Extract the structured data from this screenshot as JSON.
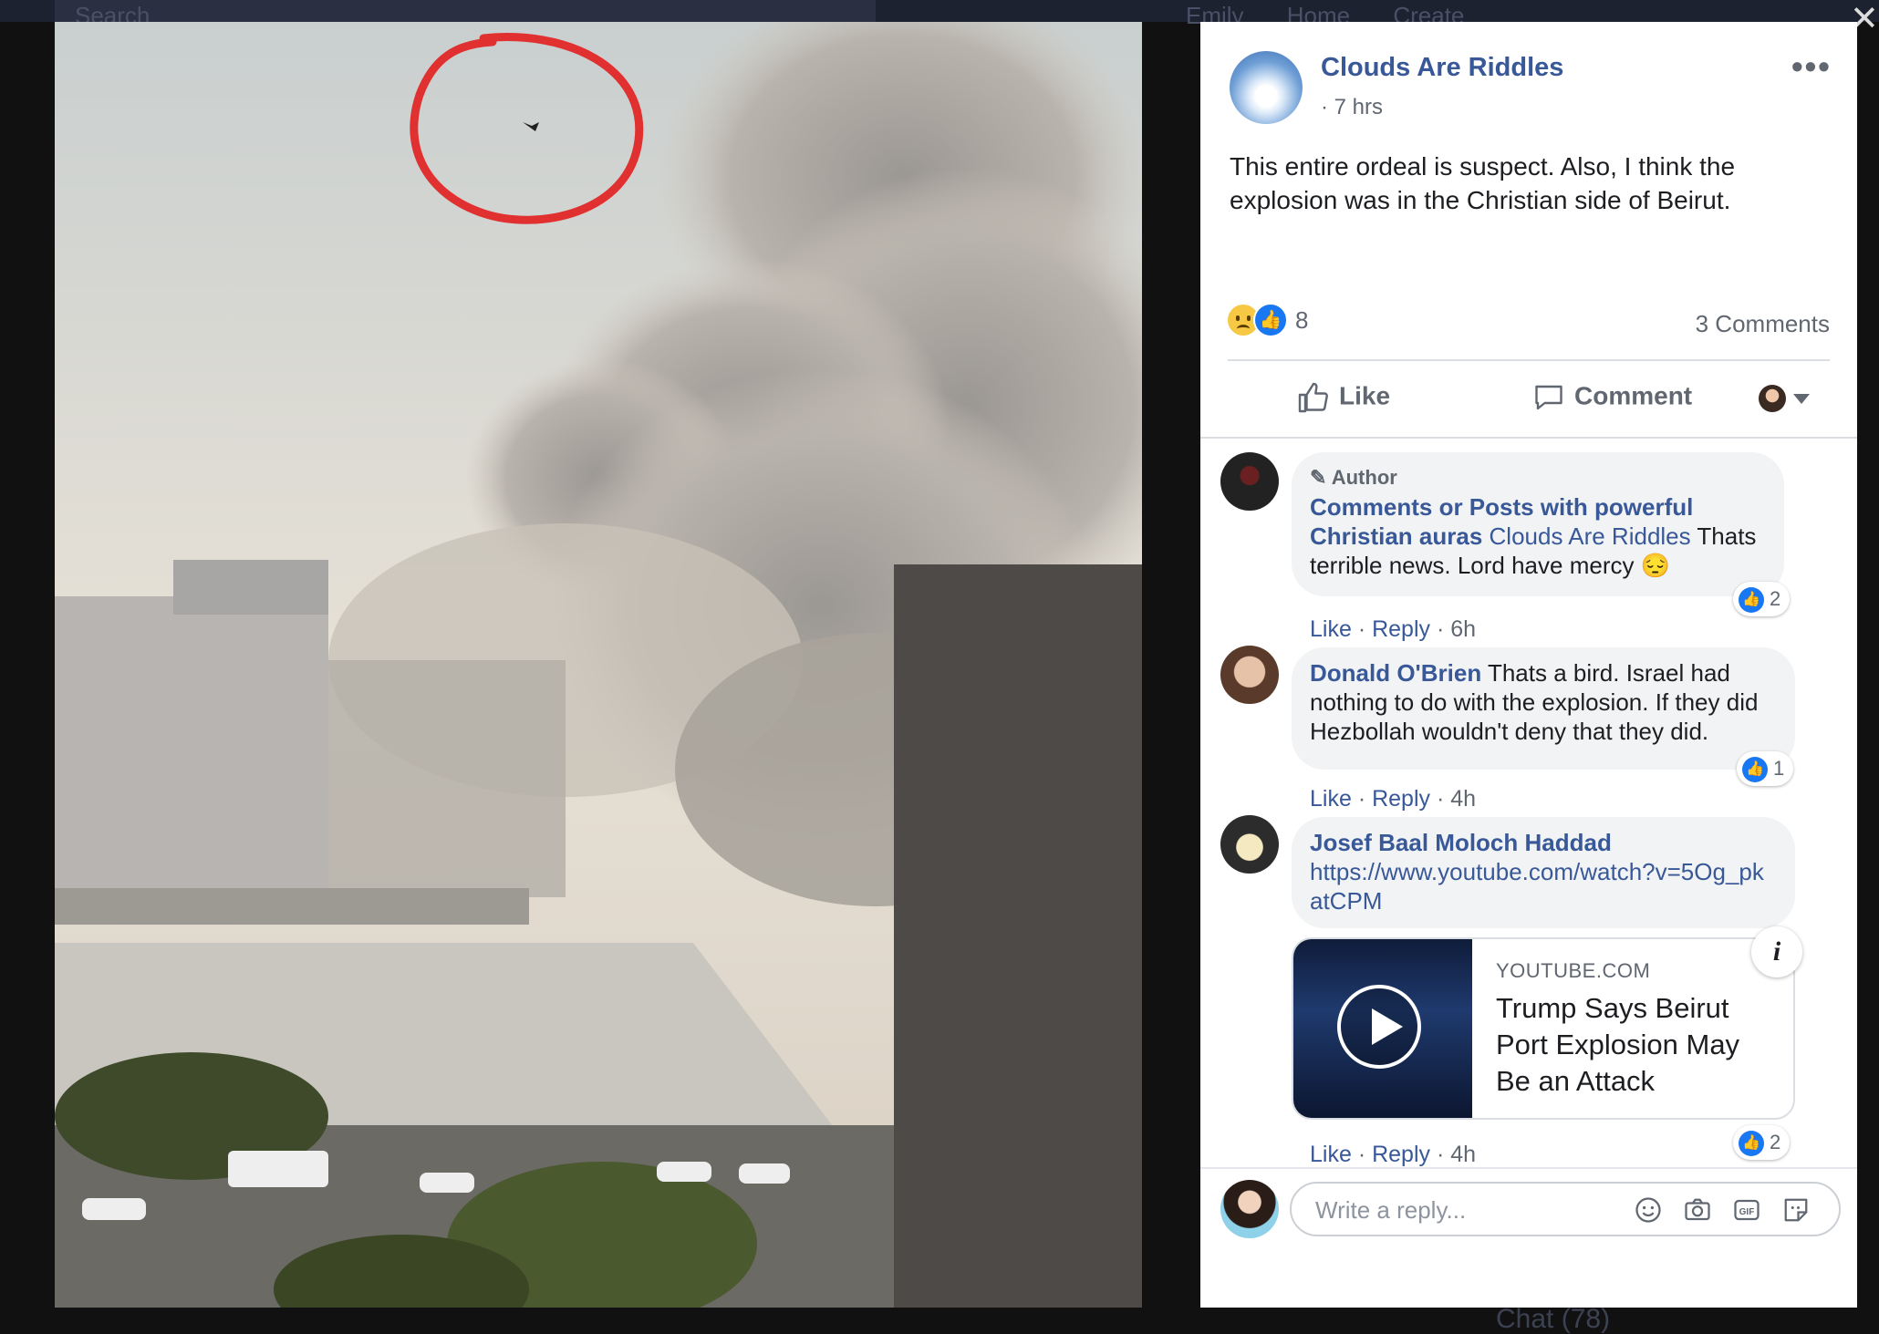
{
  "topbar": {
    "search_placeholder": "Search",
    "nav_text": "Emily  Home  Create"
  },
  "bottombar": {
    "chat_label": "Chat (78)"
  },
  "photo": {
    "description_icon": "explosion-photo"
  },
  "post": {
    "page_name": "Clouds Are Riddles",
    "time": "· 7 hrs",
    "text": "This entire ordeal is suspect. Also, I think the explosion was in the Christian side of Beirut.",
    "reaction_count": "8",
    "comments_count": "3 Comments",
    "actions": {
      "like": "Like",
      "comment": "Comment"
    }
  },
  "comments": [
    {
      "badge": "Author",
      "author": "Comments or Posts with powerful Christian auras",
      "mention": "Clouds Are Riddles",
      "text": " Thats terrible news. Lord have mercy 😔",
      "like": "Like",
      "reply": "Reply",
      "time": "6h",
      "reactions": "2"
    },
    {
      "author": "Donald O'Brien",
      "text": " Thats a bird. Israel had nothing to do with the explosion. If they did Hezbollah wouldn't deny that they did.",
      "like": "Like",
      "reply": "Reply",
      "time": "4h",
      "reactions": "1"
    },
    {
      "author": "Josef Baal Moloch Haddad",
      "link": "https://www.youtube.com/watch?v=5Og_pkatCPM",
      "card": {
        "domain": "YOUTUBE.COM",
        "title": "Trump Says Beirut Port Explosion May Be an Attack"
      },
      "like": "Like",
      "reply": "Reply",
      "time": "4h",
      "reactions": "2"
    }
  ],
  "reply_box": {
    "placeholder": "Write a reply..."
  },
  "colors": {
    "link_blue": "#385898",
    "like_blue": "#1877f2",
    "circle_red": "#e03030"
  }
}
